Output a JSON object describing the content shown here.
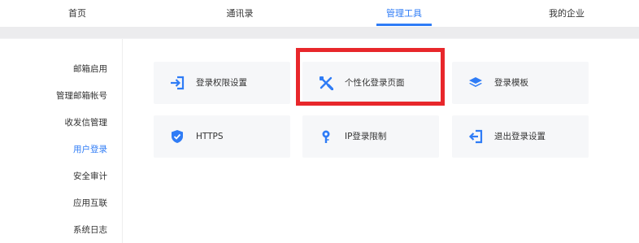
{
  "topnav": {
    "tabs": [
      {
        "label": "首页"
      },
      {
        "label": "通讯录"
      },
      {
        "label": "管理工具"
      },
      {
        "label": "我的企业"
      }
    ],
    "active_tab": "管理工具"
  },
  "sidebar": {
    "items": [
      {
        "label": "邮箱启用"
      },
      {
        "label": "管理邮箱帐号"
      },
      {
        "label": "收发信管理"
      },
      {
        "label": "用户登录"
      },
      {
        "label": "安全审计"
      },
      {
        "label": "应用互联"
      },
      {
        "label": "系统日志"
      }
    ],
    "active_item": "用户登录"
  },
  "cards": [
    {
      "label": "登录权限设置",
      "icon": "login-arrow-icon"
    },
    {
      "label": "个性化登录页面",
      "icon": "tools-icon"
    },
    {
      "label": "登录模板",
      "icon": "layers-icon"
    },
    {
      "label": "HTTPS",
      "icon": "shield-check-icon"
    },
    {
      "label": "IP登录限制",
      "icon": "location-pin-icon"
    },
    {
      "label": "退出登录设置",
      "icon": "logout-arrow-icon"
    }
  ],
  "colors": {
    "accent": "#2f7cf6",
    "highlight_border": "#e8272b",
    "card_bg": "#f6f7f9"
  }
}
